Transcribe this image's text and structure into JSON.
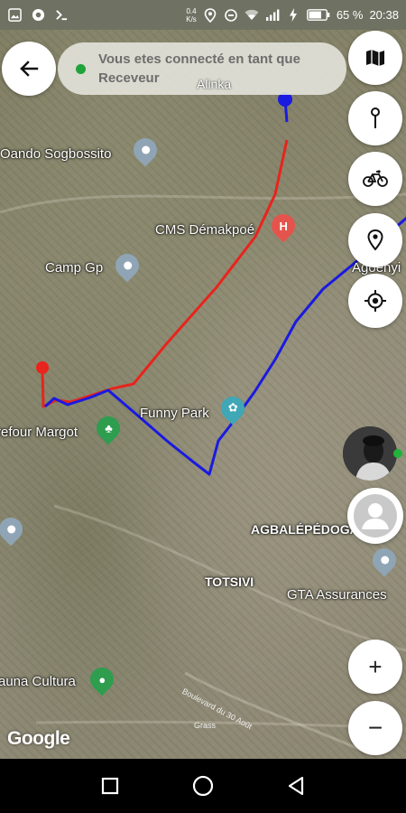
{
  "status_bar": {
    "speed_value": "0.4",
    "speed_unit": "K/s",
    "battery_percent": "65 %",
    "time": "20:38"
  },
  "connection_banner": {
    "text": "Vous etes connecté en tant que Receveur",
    "overlay_label": "Alinka",
    "dot_color": "#1fa33a"
  },
  "map": {
    "places": {
      "oando": "Oando Sogbossito",
      "cms": "CMS Démakpoé",
      "camp": "Camp Gp",
      "agoe": "Agoényi",
      "margot": "refour Margot",
      "funny_park": "Funny Park",
      "agbalepedo": "AGBALÉPÉDOGA",
      "totsivi": "TOTSIVI",
      "gta": "GTA Assurances",
      "fauna": "auna Cultura"
    },
    "road_labels": {
      "boulevard": "Boulevard du 30 Août",
      "grass": "Grass"
    },
    "route_colors": {
      "red": "#e8241c",
      "blue": "#1a1ae0"
    },
    "attribution": "Google"
  },
  "fabs": {
    "layers_icon": "map-icon",
    "pin_icon": "pushpin-icon",
    "bike_icon": "bicycle-icon",
    "location_icon": "location-pin-icon",
    "gps_icon": "my-location-icon",
    "zoom_in": "+",
    "zoom_out": "−"
  }
}
